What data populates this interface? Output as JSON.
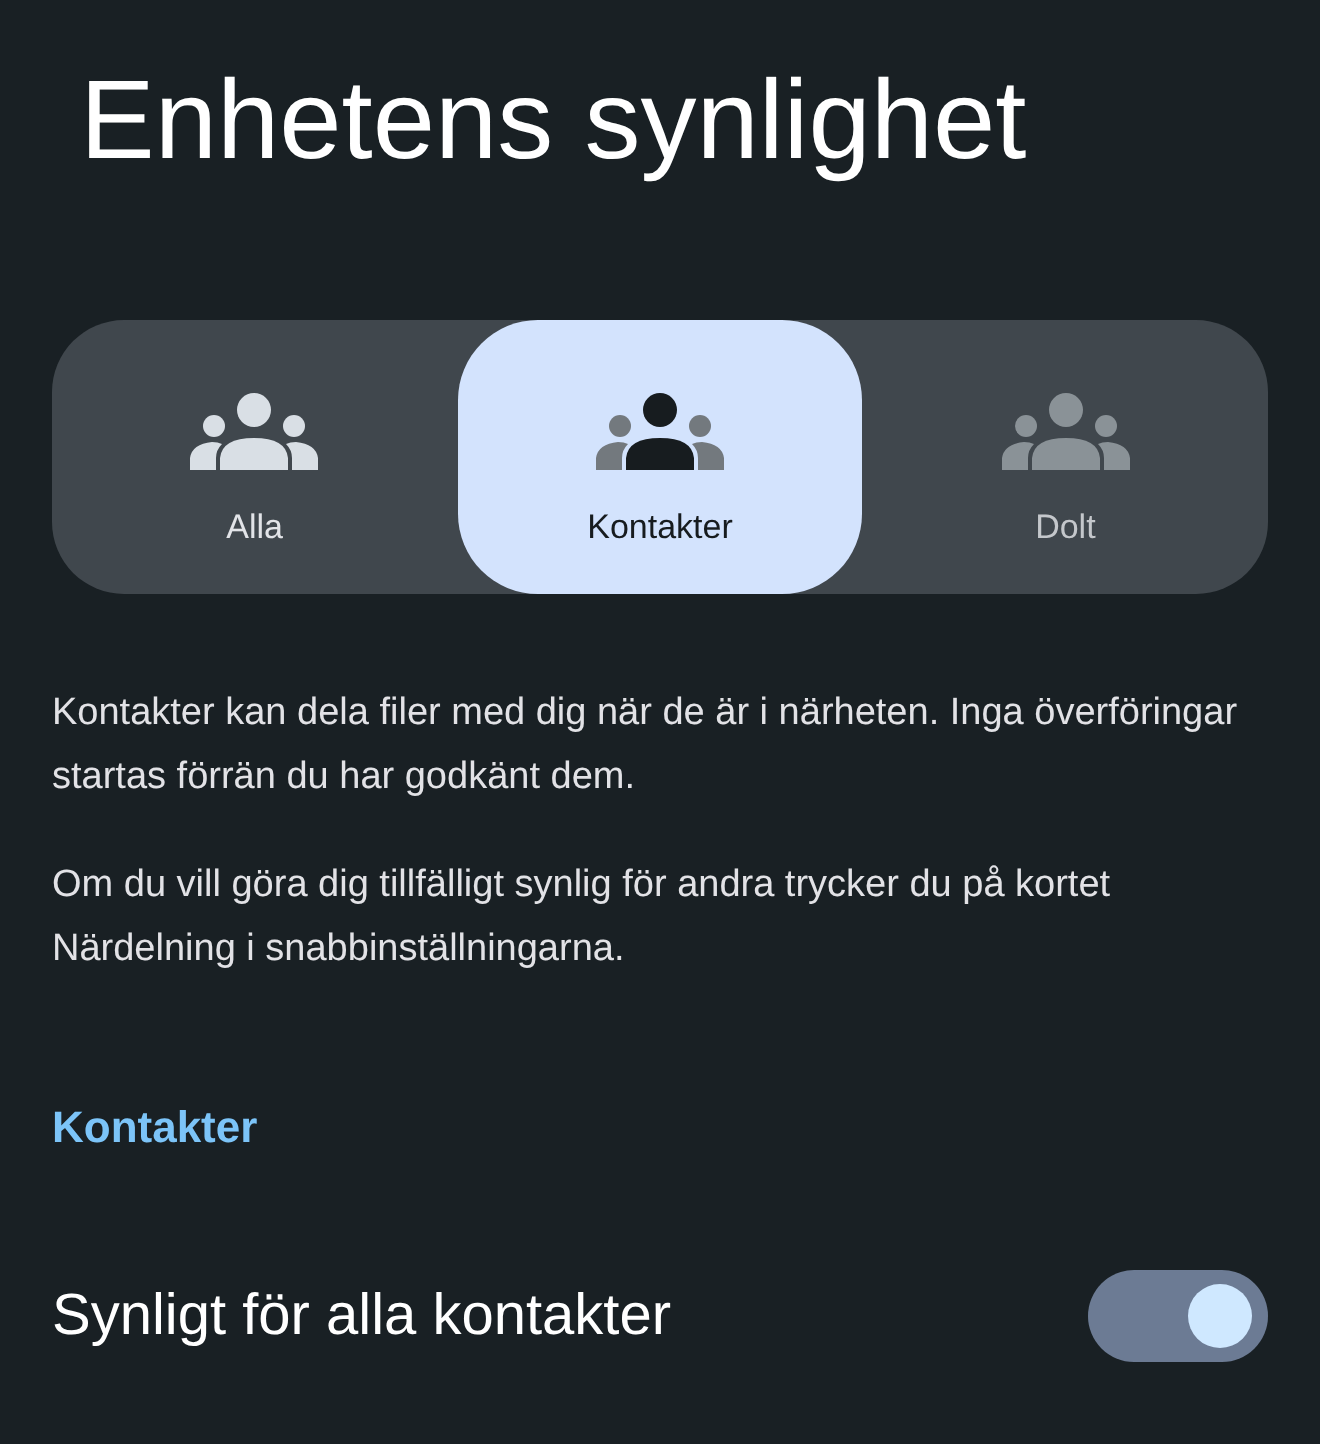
{
  "title": "Enhetens synlighet",
  "visibility_options": [
    {
      "label": "Alla",
      "selected": false,
      "disabled": false
    },
    {
      "label": "Kontakter",
      "selected": true,
      "disabled": false
    },
    {
      "label": "Dolt",
      "selected": false,
      "disabled": true
    }
  ],
  "description": [
    "Kontakter kan dela filer med dig när de är i närheten. Inga överföringar startas förrän du har godkänt dem.",
    "Om du vill göra dig tillfälligt synlig för andra trycker du på kortet Närdelning i snabbinställningarna."
  ],
  "section_header": "Kontakter",
  "setting": {
    "label": "Synligt för alla kontakter",
    "on": true
  }
}
